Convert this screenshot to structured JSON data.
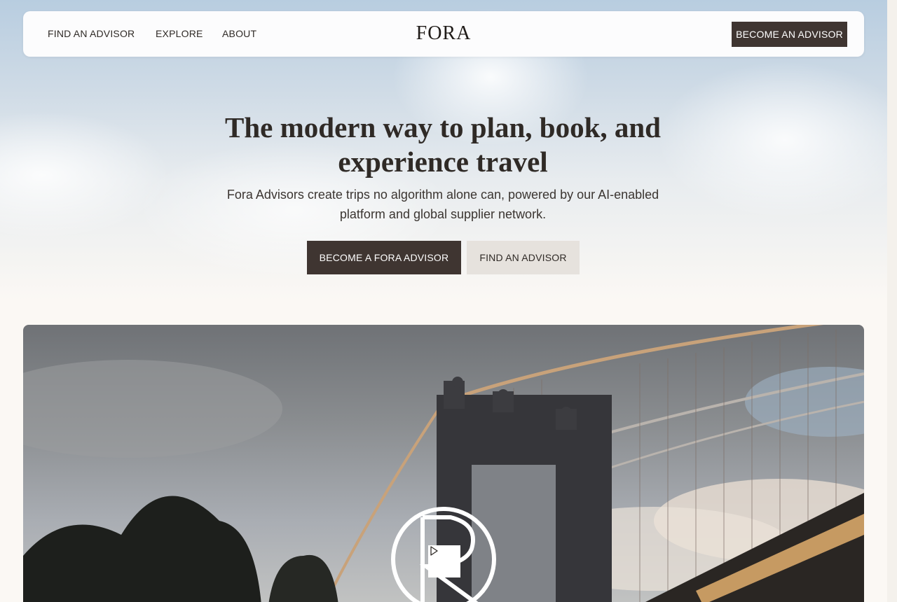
{
  "nav": {
    "links": [
      "FIND AN ADVISOR",
      "EXPLORE",
      "ABOUT"
    ],
    "logo": "FORA",
    "cta": "BECOME AN ADVISOR"
  },
  "hero": {
    "title": "The modern way to plan, book, and experience travel",
    "subtitle": "Fora Advisors create trips no algorithm alone can, powered by our AI-enabled platform and global supplier network.",
    "primary_button": "BECOME A FORA ADVISOR",
    "secondary_button": "FIND AN ADVISOR"
  },
  "video": {
    "play_icon": "play-icon",
    "overlay_logo": "fora-monogram"
  },
  "colors": {
    "dark_button": "#3f3531",
    "light_button": "#e6e2dd",
    "page_bg": "#fbf8f4"
  }
}
